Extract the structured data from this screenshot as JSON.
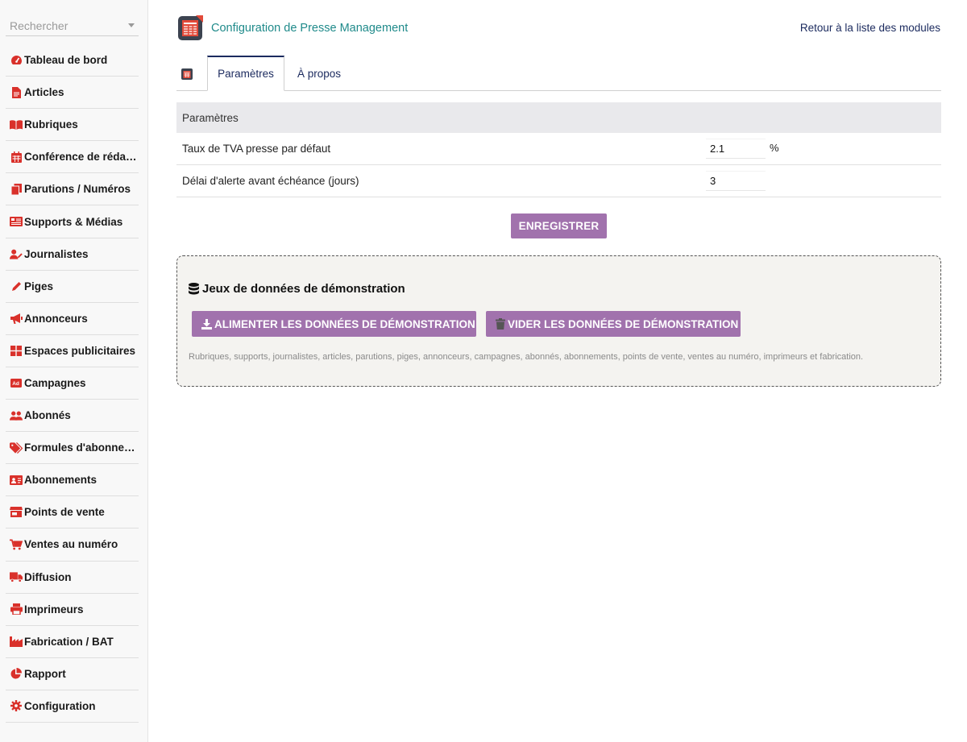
{
  "search": {
    "placeholder": "Rechercher"
  },
  "sidebar": {
    "items": [
      {
        "label": "Tableau de bord",
        "icon": "gauge-icon"
      },
      {
        "label": "Articles",
        "icon": "file-icon"
      },
      {
        "label": "Rubriques",
        "icon": "book-icon"
      },
      {
        "label": "Conférence de rédac…",
        "icon": "calendar-icon"
      },
      {
        "label": "Parutions / Numéros",
        "icon": "copy-icon"
      },
      {
        "label": "Supports & Médias",
        "icon": "newspaper-icon"
      },
      {
        "label": "Journalistes",
        "icon": "user-pen-icon"
      },
      {
        "label": "Piges",
        "icon": "pencil-icon"
      },
      {
        "label": "Annonceurs",
        "icon": "megaphone-icon"
      },
      {
        "label": "Espaces publicitaires",
        "icon": "grid-icon"
      },
      {
        "label": "Campagnes",
        "icon": "ad-icon"
      },
      {
        "label": "Abonnés",
        "icon": "users-icon"
      },
      {
        "label": "Formules d'abonne…",
        "icon": "tags-icon"
      },
      {
        "label": "Abonnements",
        "icon": "id-card-icon"
      },
      {
        "label": "Points de vente",
        "icon": "store-icon"
      },
      {
        "label": "Ventes au numéro",
        "icon": "cart-icon"
      },
      {
        "label": "Diffusion",
        "icon": "truck-icon"
      },
      {
        "label": "Imprimeurs",
        "icon": "printer-icon"
      },
      {
        "label": "Fabrication / BAT",
        "icon": "industry-icon"
      },
      {
        "label": "Rapport",
        "icon": "pie-chart-icon"
      },
      {
        "label": "Configuration",
        "icon": "gear-icon"
      }
    ]
  },
  "header": {
    "title": "Configuration de Presse Management",
    "back_link": "Retour à la liste des modules"
  },
  "tabs": [
    {
      "label": "Paramètres",
      "active": true
    },
    {
      "label": "À propos",
      "active": false
    }
  ],
  "params": {
    "section_title": "Paramètres",
    "rows": [
      {
        "label": "Taux de TVA presse par défaut",
        "value": "2.1",
        "unit": "%"
      },
      {
        "label": "Délai d'alerte avant échéance (jours)",
        "value": "3",
        "unit": ""
      }
    ],
    "save_label": "ENREGISTRER"
  },
  "demo": {
    "title": "Jeux de données de démonstration",
    "fill_label": "ALIMENTER LES DONNÉES DE DÉMONSTRATION",
    "clear_label": "VIDER LES DONNÉES DE DÉMONSTRATION",
    "note": "Rubriques, supports, journalistes, articles, parutions, piges, annonceurs, campagnes, abonnés, abonnements, points de vente, ventes au numéro, imprimeurs et fabrication."
  },
  "colors": {
    "accent": "#a172ad",
    "icon_red": "#d9312b",
    "title_teal": "#1f8a8a",
    "link_navy": "#1b2a5e"
  }
}
